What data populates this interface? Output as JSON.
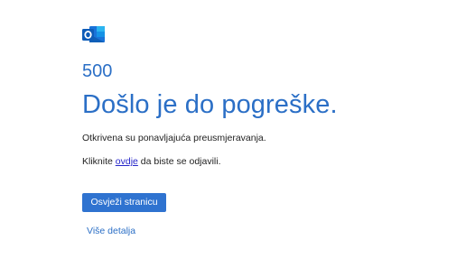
{
  "app": {
    "logo_icon": "outlook-logo-icon",
    "brand_color": "#2b6fc6"
  },
  "error": {
    "code": "500",
    "title": "Došlo je do pogreške.",
    "message": "Otkrivena su ponavljajuća preusmjeravanja.",
    "signout_prefix": "Kliknite ",
    "signout_link": "ovdje",
    "signout_suffix": " da biste se odjavili."
  },
  "actions": {
    "refresh_label": "Osvježi stranicu",
    "details_label": "Više detalja"
  }
}
